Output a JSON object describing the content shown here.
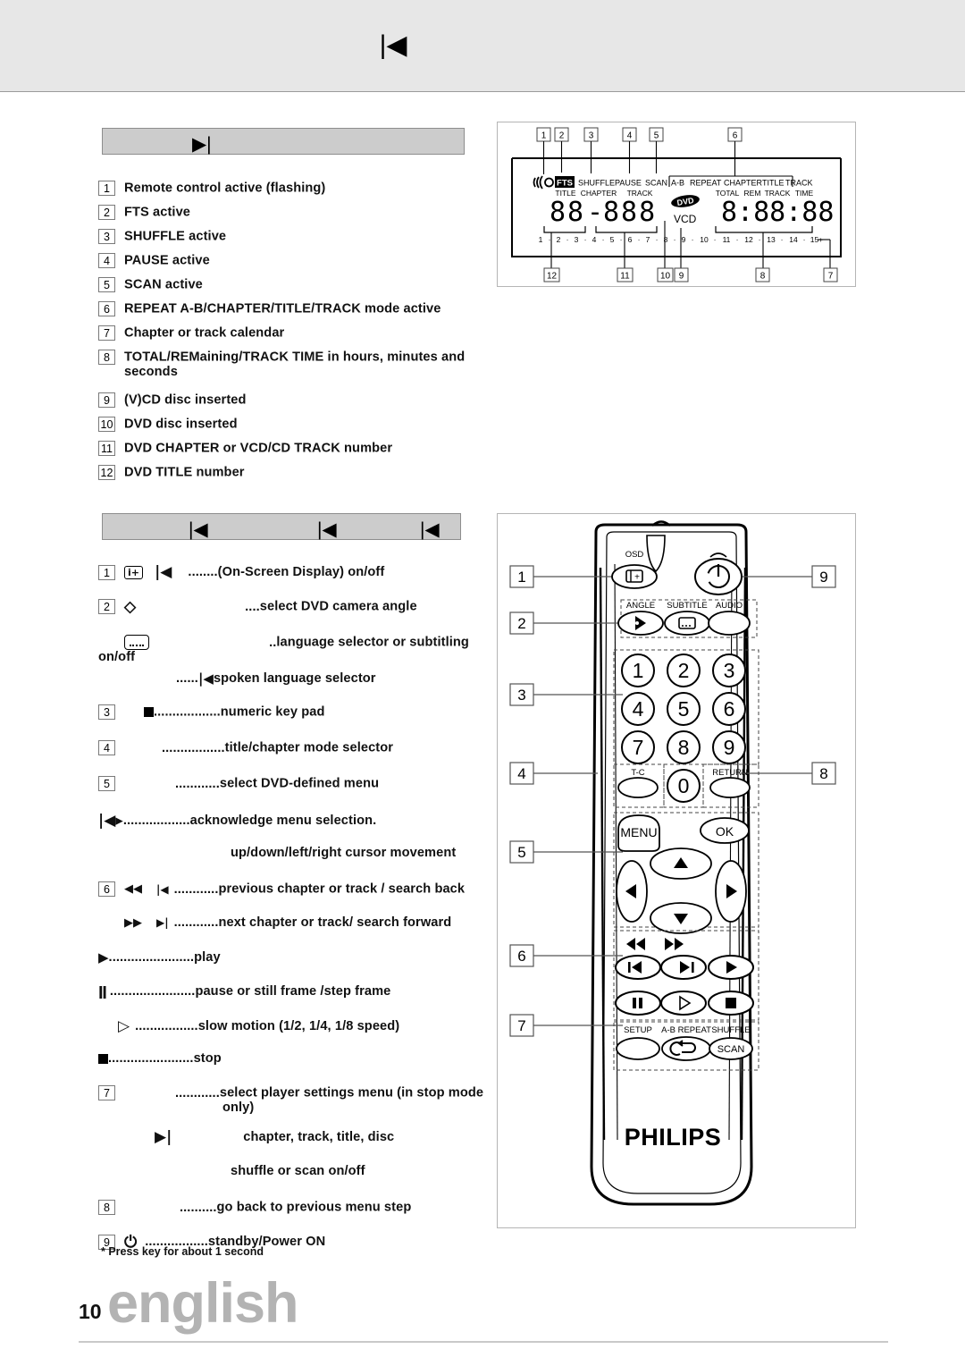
{
  "top_band": {
    "glyph": "previous-track-arrow",
    "glyph_char": "|◀"
  },
  "section_display": {
    "header_glyph": "▶|",
    "items": [
      {
        "num": "1",
        "text": "Remote control active (flashing)"
      },
      {
        "num": "2",
        "text": "FTS active"
      },
      {
        "num": "3",
        "text": "SHUFFLE active"
      },
      {
        "num": "4",
        "text": "PAUSE active"
      },
      {
        "num": "5",
        "text": "SCAN active"
      },
      {
        "num": "6",
        "text": "REPEAT A-B/CHAPTER/TITLE/TRACK mode active"
      },
      {
        "num": "7",
        "text": "Chapter or track calendar"
      },
      {
        "num": "8",
        "text": "TOTAL/REMaining/TRACK TIME in hours, minutes and",
        "text2": "seconds"
      },
      {
        "num": "9",
        "text": "(V)CD disc inserted"
      },
      {
        "num": "10",
        "text": "DVD disc inserted"
      },
      {
        "num": "11",
        "text": "DVD CHAPTER or VCD/CD TRACK number"
      },
      {
        "num": "12",
        "text": "DVD TITLE number"
      }
    ]
  },
  "display_panel": {
    "callouts_top": [
      "1",
      "2",
      "3",
      "4",
      "5",
      "6"
    ],
    "callouts_bottom": [
      "12",
      "11",
      "10",
      "9",
      "8",
      "7"
    ],
    "indicators": [
      "SHUFFLE",
      "PAUSE",
      "SCAN"
    ],
    "fts_label": "FTS",
    "repeat_group": [
      "A-B",
      "REPEAT",
      "CHAPTER",
      "TITLE",
      "TRACK"
    ],
    "field_labels_left": [
      "TITLE",
      "CHAPTER",
      "TRACK"
    ],
    "field_labels_right": [
      "TOTAL",
      "REM",
      "TRACK",
      "TIME"
    ],
    "disc_dvd": "DVD",
    "disc_vcd": "VCD",
    "segments_left": "88 - 888",
    "segments_right": "8:88:88",
    "calendar": [
      "1",
      "2",
      "3",
      "4",
      "5",
      "6",
      "7",
      "8",
      "9",
      "10",
      "11",
      "12",
      "13",
      "14",
      "15+"
    ]
  },
  "section_remote": {
    "header_glyphs": [
      "|◀",
      "|◀",
      "|◀"
    ],
    "rows": [
      {
        "num": "1",
        "icon": "osd-box-plus",
        "icon2": "prev-track",
        "dots": "........",
        "text": "(On-Screen Display) on/off",
        "indent": "a"
      },
      {
        "num": "2",
        "icon": "angle-diamond",
        "dots": "....",
        "text": "select DVD camera angle",
        "indent": "b"
      },
      {
        "num": "",
        "icon": "subtitle-box",
        "dots": "..",
        "text": "language selector or subtitling on/off",
        "indent": "c"
      },
      {
        "num": "",
        "icon": "prev-track-small",
        "dots": "......",
        "text": "spoken language selector",
        "indent": "d"
      },
      {
        "num": "3",
        "icon": "filled-square",
        "dots": "..................",
        "text": "numeric key pad",
        "indent": "e"
      },
      {
        "num": "4",
        "icon": "",
        "dots": ".................",
        "text": "title/chapter mode selector",
        "indent": "f"
      },
      {
        "num": "5",
        "icon": "",
        "dots": "............",
        "text": "select DVD-defined menu",
        "indent": "g"
      },
      {
        "num": "",
        "icon": "prev-next-combo",
        "dots": "..................",
        "text": "acknowledge menu selection.",
        "indent": "h"
      },
      {
        "num": "",
        "icon": "",
        "dots": "",
        "text": "up/down/left/right cursor movement",
        "indent": "i"
      },
      {
        "num": "6",
        "icon": "rewind",
        "icon2": "prev",
        "dots": "............",
        "text": "previous chapter or track / search back",
        "indent": "j"
      },
      {
        "num": "",
        "icon": "forward",
        "icon2": "next",
        "dots": "............",
        "text": "next chapter or track/ search forward",
        "indent": "k"
      },
      {
        "num": "",
        "icon": "play",
        "dots": ".......................",
        "text": "play",
        "indent": "l"
      },
      {
        "num": "",
        "icon": "pause",
        "dots": ".......................",
        "text": "pause or still frame /step frame",
        "indent": "m"
      },
      {
        "num": "",
        "icon": "slow",
        "dots": ".................",
        "text": "slow motion (1/2, 1/4, 1/8 speed)",
        "indent": "n"
      },
      {
        "num": "",
        "icon": "stop",
        "dots": ".......................",
        "text": "stop",
        "indent": "o"
      },
      {
        "num": "7",
        "icon": "",
        "dots": "............",
        "text": "select player settings menu (in stop mode",
        "text2": "only)",
        "indent": "p"
      },
      {
        "num": "",
        "icon": "next-track",
        "dots": "",
        "text": "chapter, track, title, disc",
        "indent": "q"
      },
      {
        "num": "",
        "icon": "",
        "dots": "",
        "text": "shuffle or scan on/off",
        "indent": "r"
      },
      {
        "num": "8",
        "icon": "",
        "dots": "..........",
        "text": "go back to previous menu step",
        "indent": "s"
      },
      {
        "num": "9",
        "icon": "power",
        "dots": ".................",
        "text": "standby/Power ON",
        "indent": "t"
      }
    ]
  },
  "remote": {
    "callouts_left": [
      "1",
      "2",
      "3",
      "4",
      "5",
      "6",
      "7"
    ],
    "callouts_right": [
      "9",
      "8"
    ],
    "labels": {
      "osd": "OSD",
      "angle": "ANGLE",
      "subtitle": "SUBTITLE",
      "audio": "AUDIO",
      "tc": "T-C",
      "return": "RETURN",
      "menu": "MENU",
      "ok": "OK",
      "setup": "SETUP",
      "ab_repeat": "A-B REPEAT",
      "shuffle": "SHUFFLE",
      "scan": "SCAN"
    },
    "keypad": [
      "1",
      "2",
      "3",
      "4",
      "5",
      "6",
      "7",
      "8",
      "9",
      "0"
    ],
    "brand": "PHILIPS"
  },
  "footnote": "*  Press key for about 1 second",
  "footer": {
    "page_number": "10",
    "language": "english"
  }
}
